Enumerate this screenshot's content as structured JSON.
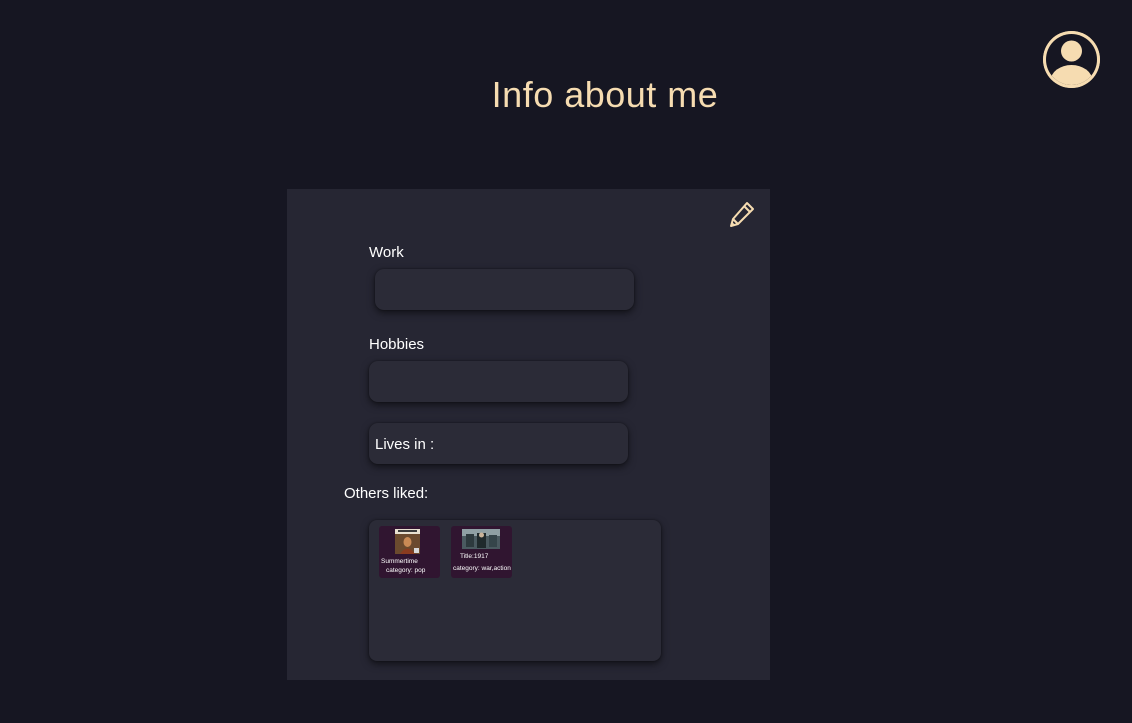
{
  "header": {
    "title": "Info about me",
    "avatar_icon": "user-avatar-icon"
  },
  "profile_card": {
    "edit_icon": "pencil-icon",
    "work": {
      "label": "Work",
      "value": ""
    },
    "hobbies": {
      "label": "Hobbies",
      "value": ""
    },
    "lives_in": {
      "label": "Lives in :",
      "value": ""
    },
    "others_liked": {
      "label": "Others liked:",
      "items": [
        {
          "line1": "Summertime",
          "line2": "category: pop"
        },
        {
          "line1": "Title:1917",
          "line2": "category: war,action"
        }
      ]
    }
  },
  "colors": {
    "background": "#161622",
    "card": "#262633",
    "field": "#2b2b37",
    "accent": "#f6dcb1",
    "tile": "#301530"
  }
}
